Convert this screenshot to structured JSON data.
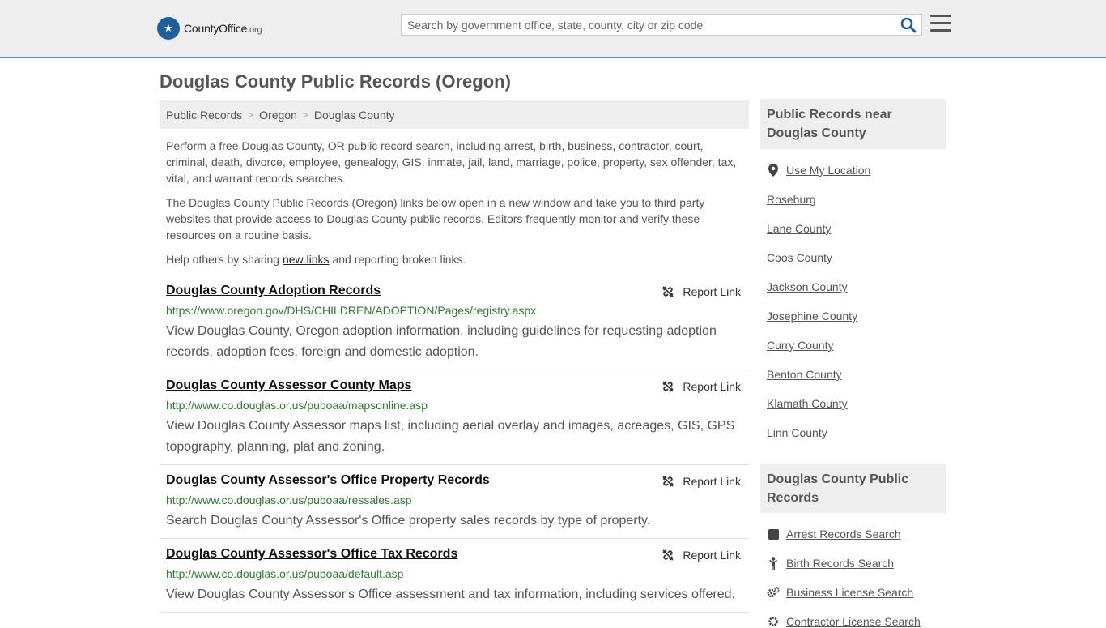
{
  "header": {
    "logo_text_main": "CountyOffice",
    "logo_text_tld": ".org",
    "search_placeholder": "Search by government office, state, county, city or zip code"
  },
  "page": {
    "title": "Douglas County Public Records (Oregon)"
  },
  "breadcrumb": [
    "Public Records",
    "Oregon",
    "Douglas County"
  ],
  "intro": {
    "p1": "Perform a free Douglas County, OR public record search, including arrest, birth, business, contractor, court, criminal, death, divorce, employee, genealogy, GIS, inmate, jail, land, marriage, police, property, sex offender, tax, vital, and warrant records searches.",
    "p2": "The Douglas County Public Records (Oregon) links below open in a new window and take you to third party websites that provide access to Douglas County public records. Editors frequently monitor and verify these resources on a routine basis.",
    "p3_before": "Help others by sharing ",
    "p3_link": "new links",
    "p3_after": " and reporting broken links."
  },
  "report_label": "Report Link",
  "records": [
    {
      "title": "Douglas County Adoption Records",
      "url": "https://www.oregon.gov/DHS/CHILDREN/ADOPTION/Pages/registry.aspx",
      "desc": "View Douglas County, Oregon adoption information, including guidelines for requesting adoption records, adoption fees, foreign and domestic adoption."
    },
    {
      "title": "Douglas County Assessor County Maps",
      "url": "http://www.co.douglas.or.us/puboaa/mapsonline.asp",
      "desc": "View Douglas County Assessor maps list, including aerial overlay and images, acreages, GIS, GPS topography, planning, plat and zoning."
    },
    {
      "title": "Douglas County Assessor's Office Property Records",
      "url": "http://www.co.douglas.or.us/puboaa/ressales.asp",
      "desc": "Search Douglas County Assessor's Office property sales records by type of property."
    },
    {
      "title": "Douglas County Assessor's Office Tax Records",
      "url": "http://www.co.douglas.or.us/puboaa/default.asp",
      "desc": "View Douglas County Assessor's Office assessment and tax information, including services offered."
    }
  ],
  "sidebar": {
    "nearby_heading": "Public Records near Douglas County",
    "use_location": "Use My Location",
    "nearby": [
      "Roseburg",
      "Lane County",
      "Coos County",
      "Jackson County",
      "Josephine County",
      "Curry County",
      "Benton County",
      "Klamath County",
      "Linn County"
    ],
    "county_heading": "Douglas County Public Records",
    "county_links": [
      "Arrest Records Search",
      "Birth Records Search",
      "Business License Search",
      "Contractor License Search"
    ]
  }
}
